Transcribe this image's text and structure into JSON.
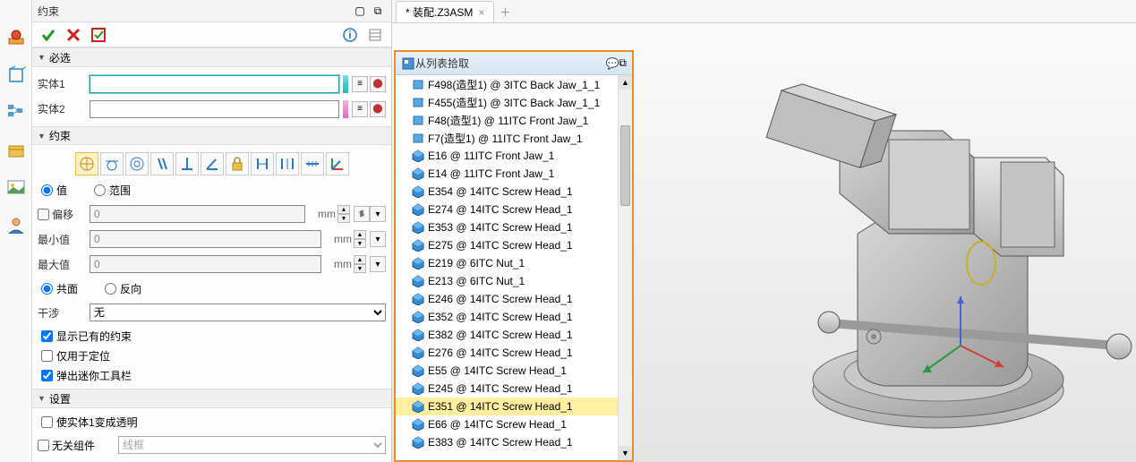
{
  "panel": {
    "title": "约束",
    "sections": {
      "required": "必选",
      "constraint": "约束",
      "settings": "设置"
    },
    "entity1_label": "实体1",
    "entity2_label": "实体2",
    "entity1_value": "",
    "entity2_value": "",
    "value_radio": "值",
    "range_radio": "范围",
    "offset_label": "偏移",
    "offset_value": "0",
    "min_label": "最小值",
    "min_value": "0",
    "max_label": "最大值",
    "max_value": "0",
    "unit": "mm",
    "coplane_radio": "共面",
    "reverse_radio": "反向",
    "interf_label": "干涉",
    "interf_value": "无",
    "chk_show_existing": "显示已有的约束",
    "chk_locate_only": "仅用于定位",
    "chk_mini_toolbar": "弹出迷你工具栏",
    "chk_transparent": "使实体1变成透明",
    "chk_unrelated": "无关组件",
    "wireframe": "线框"
  },
  "tab": {
    "label": "* 装配.Z3ASM"
  },
  "picklist": {
    "title": "从列表拾取",
    "items": [
      "F498(造型1) @ 3ITC Back Jaw_1_1",
      "F455(造型1) @ 3ITC Back Jaw_1_1",
      "F48(造型1) @ 11ITC Front Jaw_1",
      "F7(造型1) @ 11ITC Front Jaw_1",
      "E16 @ 11ITC Front Jaw_1",
      "E14 @ 11ITC Front Jaw_1",
      "E354 @ 14ITC Screw Head_1",
      "E274 @ 14ITC Screw Head_1",
      "E353 @ 14ITC Screw Head_1",
      "E275 @ 14ITC Screw Head_1",
      "E219 @ 6ITC Nut_1",
      "E213 @ 6ITC Nut_1",
      "E246 @ 14ITC Screw Head_1",
      "E352 @ 14ITC Screw Head_1",
      "E382 @ 14ITC Screw Head_1",
      "E276 @ 14ITC Screw Head_1",
      "E55 @ 14ITC Screw Head_1",
      "E245 @ 14ITC Screw Head_1",
      "E351 @ 14ITC Screw Head_1",
      "E66 @ 14ITC Screw Head_1",
      "E383 @ 14ITC Screw Head_1"
    ],
    "selected_index": 18
  }
}
